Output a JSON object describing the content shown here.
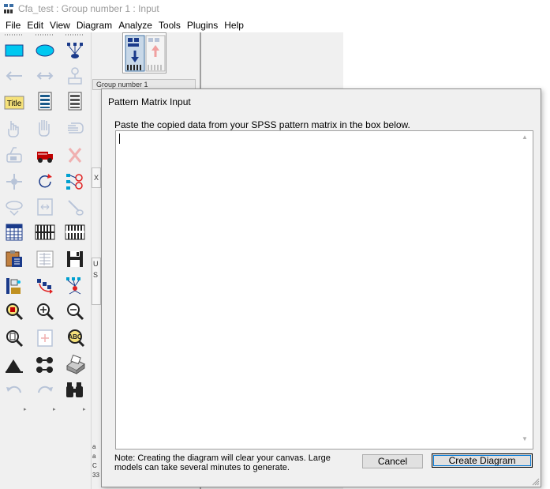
{
  "window": {
    "title": "Cfa_test : Group number 1 : Input"
  },
  "menu": [
    {
      "label": "File"
    },
    {
      "label": "Edit"
    },
    {
      "label": "View"
    },
    {
      "label": "Diagram"
    },
    {
      "label": "Analyze"
    },
    {
      "label": "Tools"
    },
    {
      "label": "Plugins"
    },
    {
      "label": "Help"
    }
  ],
  "toolbox": {
    "tools": [
      {
        "icon": "rectangle-icon"
      },
      {
        "icon": "ellipse-icon"
      },
      {
        "icon": "indicator-icon"
      },
      {
        "icon": "single-arrow-icon"
      },
      {
        "icon": "double-arrow-icon"
      },
      {
        "icon": "unique-variable-icon"
      },
      {
        "icon": "title-icon",
        "text": "Title"
      },
      {
        "icon": "list-variables-model-icon"
      },
      {
        "icon": "list-variables-data-icon"
      },
      {
        "icon": "select-one-icon"
      },
      {
        "icon": "select-all-icon"
      },
      {
        "icon": "deselect-all-icon"
      },
      {
        "icon": "duplicate-icon"
      },
      {
        "icon": "move-icon"
      },
      {
        "icon": "erase-icon"
      },
      {
        "icon": "move-parameter-icon"
      },
      {
        "icon": "rotate-indicator-icon"
      },
      {
        "icon": "reflect-indicator-icon"
      },
      {
        "icon": "shape-change-icon"
      },
      {
        "icon": "fit-to-page-icon"
      },
      {
        "icon": "touch-up-icon"
      },
      {
        "icon": "select-data-file-icon"
      },
      {
        "icon": "analysis-properties-icon"
      },
      {
        "icon": "calculate-estimates-icon"
      },
      {
        "icon": "copy-to-clipboard-icon"
      },
      {
        "icon": "text-output-icon"
      },
      {
        "icon": "save-icon"
      },
      {
        "icon": "object-properties-icon"
      },
      {
        "icon": "drag-properties-icon"
      },
      {
        "icon": "preserve-symmetries-icon"
      },
      {
        "icon": "zoom-area-icon"
      },
      {
        "icon": "zoom-in-icon"
      },
      {
        "icon": "zoom-out-icon"
      },
      {
        "icon": "view-page-icon"
      },
      {
        "icon": "resize-diagram-icon"
      },
      {
        "icon": "magnify-icon"
      },
      {
        "icon": "degrees-of-freedom-icon"
      },
      {
        "icon": "multiple-group-icon"
      },
      {
        "icon": "print-icon"
      },
      {
        "icon": "undo-icon"
      },
      {
        "icon": "redo-icon"
      },
      {
        "icon": "specification-search-icon"
      }
    ]
  },
  "panel": {
    "group_tab": "Group number 1",
    "x_tab": "X",
    "u_tab": "U",
    "u_sub": "S",
    "bottom_letters": [
      "a",
      "a",
      "C",
      "33"
    ]
  },
  "dialog": {
    "title": "Pattern Matrix Input",
    "instruction": "Paste the copied data from your SPSS pattern matrix in the box below.",
    "textarea_value": "",
    "note": "Note: Creating the diagram will clear your canvas. Large models can take several minutes to generate.",
    "cancel_label": "Cancel",
    "create_label": "Create Diagram"
  },
  "colors": {
    "tool_cyan": "#00c8f0",
    "tool_blue": "#1a3a8a",
    "disabled_gray": "#b8c4d8",
    "accent": "#0078d7"
  }
}
